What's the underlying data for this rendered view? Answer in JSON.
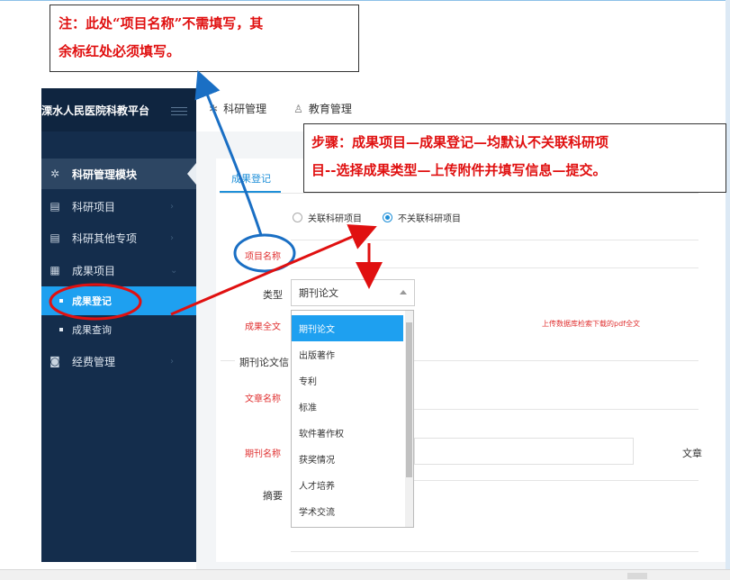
{
  "sidebar": {
    "brand": "溧水人民医院科教平台",
    "items": [
      {
        "label": "科研管理模块",
        "icon": "network-icon"
      },
      {
        "label": "科研项目",
        "icon": "document-icon"
      },
      {
        "label": "科研其他专项",
        "icon": "document-icon"
      },
      {
        "label": "成果项目",
        "icon": "clipboard-icon"
      },
      {
        "label": "经费管理",
        "icon": "coins-icon"
      }
    ],
    "subitems": [
      {
        "label": "成果登记"
      },
      {
        "label": "成果查询"
      }
    ]
  },
  "topnav": {
    "items": [
      {
        "label": "科研管理",
        "icon": "network-icon"
      },
      {
        "label": "教育管理",
        "icon": "user-icon"
      }
    ]
  },
  "main": {
    "tab": "成果登记",
    "radio_related": "关联科研项目",
    "radio_unrelated": "不关联科研项目",
    "project_name_label": "项目名称",
    "type_label": "类型",
    "type_value": "期刊论文",
    "fulltext_label": "成果全文",
    "upload_hint": "上传数据库检索下载的pdf全文",
    "section_title": "期刊论文信",
    "article_name_label": "文章名称",
    "journal_name_label": "期刊名称",
    "abstract_label": "摘要",
    "right_cut_label": "文章",
    "dropdown_options": [
      "期刊论文",
      "出版著作",
      "专利",
      "标准",
      "软件著作权",
      "获奖情况",
      "人才培养",
      "学术交流"
    ]
  },
  "annotations": {
    "note1_line1": "注：此处“项目名称”不需填写，其",
    "note1_line2": "余标红处必须填写。",
    "note2_line1": "步骤：成果项目—成果登记—均默认不关联科研项",
    "note2_line2": "目--选择成果类型—上传附件并填写信息—提交。"
  },
  "colors": {
    "sidebar_bg": "#142d4c",
    "accent": "#1ea0f0",
    "required_red": "#e03030",
    "annotation_red": "#e01010",
    "annotation_blue": "#1a6fc4"
  }
}
